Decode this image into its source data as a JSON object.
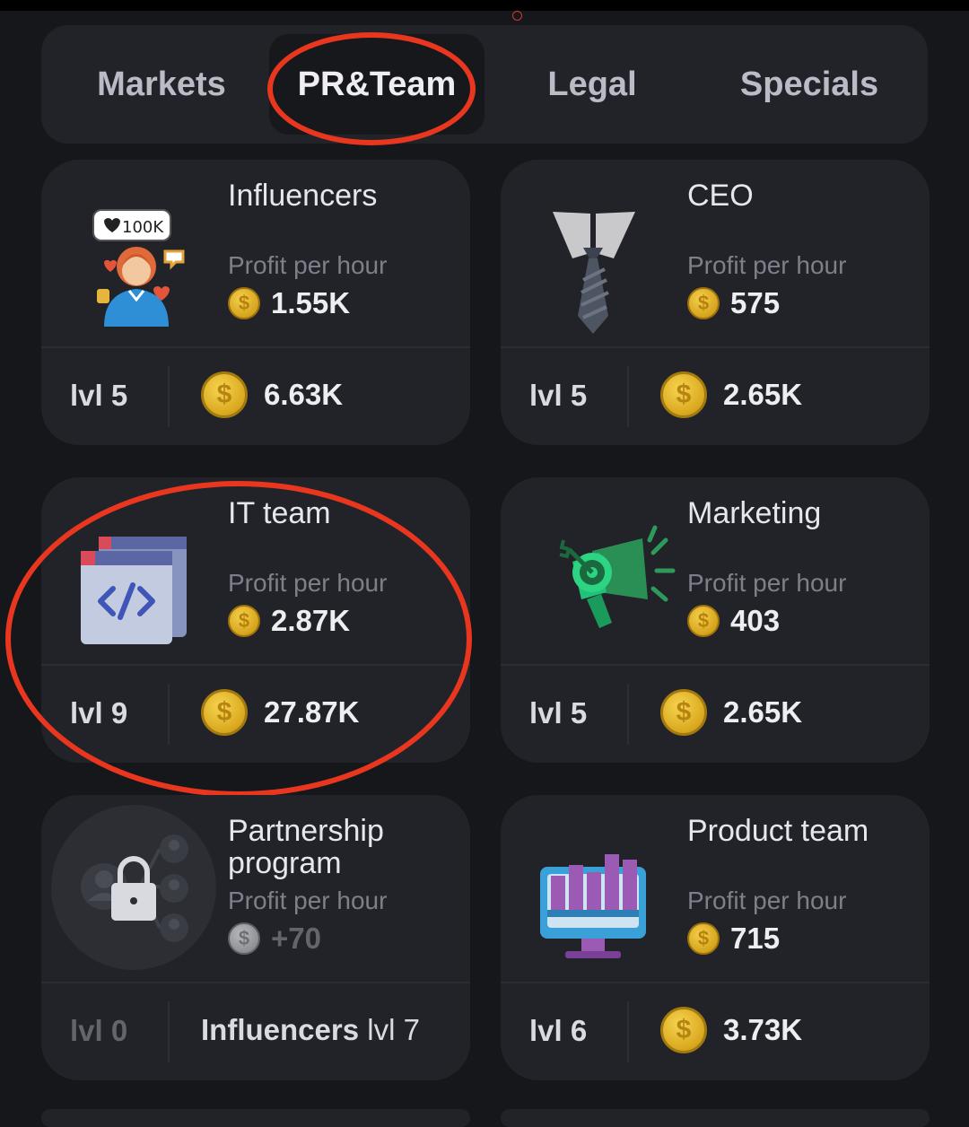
{
  "tabs": [
    {
      "label": "Markets",
      "active": false
    },
    {
      "label": "PR&Team",
      "active": true
    },
    {
      "label": "Legal",
      "active": false
    },
    {
      "label": "Specials",
      "active": false
    }
  ],
  "profit_label": "Profit per hour",
  "cards": [
    {
      "title": "Influencers",
      "icon": "influencer-icon",
      "icon_badge": "100K",
      "profit": "1.55K",
      "level": "lvl 5",
      "price": "6.63K"
    },
    {
      "title": "CEO",
      "icon": "tie-icon",
      "profit": "575",
      "level": "lvl 5",
      "price": "2.65K"
    },
    {
      "title": "IT team",
      "icon": "code-window-icon",
      "profit": "2.87K",
      "level": "lvl 9",
      "price": "27.87K"
    },
    {
      "title": "Marketing",
      "icon": "megaphone-target-icon",
      "profit": "403",
      "level": "lvl 5",
      "price": "2.65K"
    },
    {
      "title": "Partnership program",
      "icon": "locked-network-icon",
      "profit": "+70",
      "level": "lvl 0",
      "requirement_name": "Influencers",
      "requirement_level": "lvl 7",
      "locked": true
    },
    {
      "title": "Product team",
      "icon": "monitor-chart-icon",
      "profit": "715",
      "level": "lvl 6",
      "price": "3.73K"
    }
  ],
  "coin_symbol": "$",
  "colors": {
    "background": "#16171b",
    "card": "#222328",
    "annotation_red": "#e8361f",
    "coin_gold": "#e0b02a"
  }
}
